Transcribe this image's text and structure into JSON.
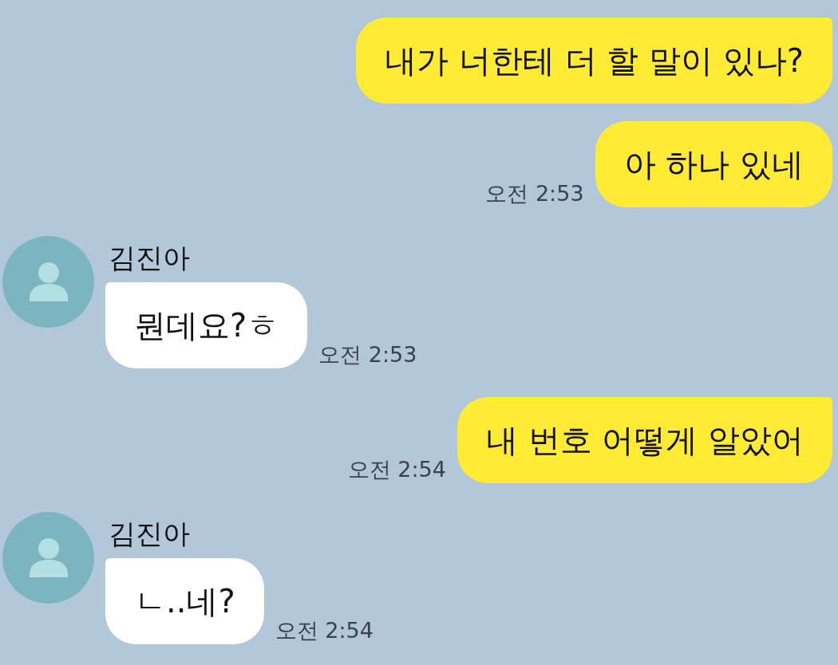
{
  "messages": [
    {
      "kind": "sent",
      "text": "내가 너한테 더 할 말이 있나?",
      "tail": true
    },
    {
      "kind": "sent",
      "text": "아 하나 있네",
      "tail": false,
      "time": "오전 2:53"
    },
    {
      "kind": "received",
      "sender": "김진아",
      "text": "뭔데요?ㅎ",
      "tail": true,
      "time": "오전 2:53"
    },
    {
      "kind": "sent",
      "text": "내 번호 어떻게 알았어",
      "tail": true,
      "time": "오전 2:54"
    },
    {
      "kind": "received",
      "sender": "김진아",
      "text": "ㄴ..네?",
      "tail": true,
      "time": "오전 2:54"
    }
  ]
}
